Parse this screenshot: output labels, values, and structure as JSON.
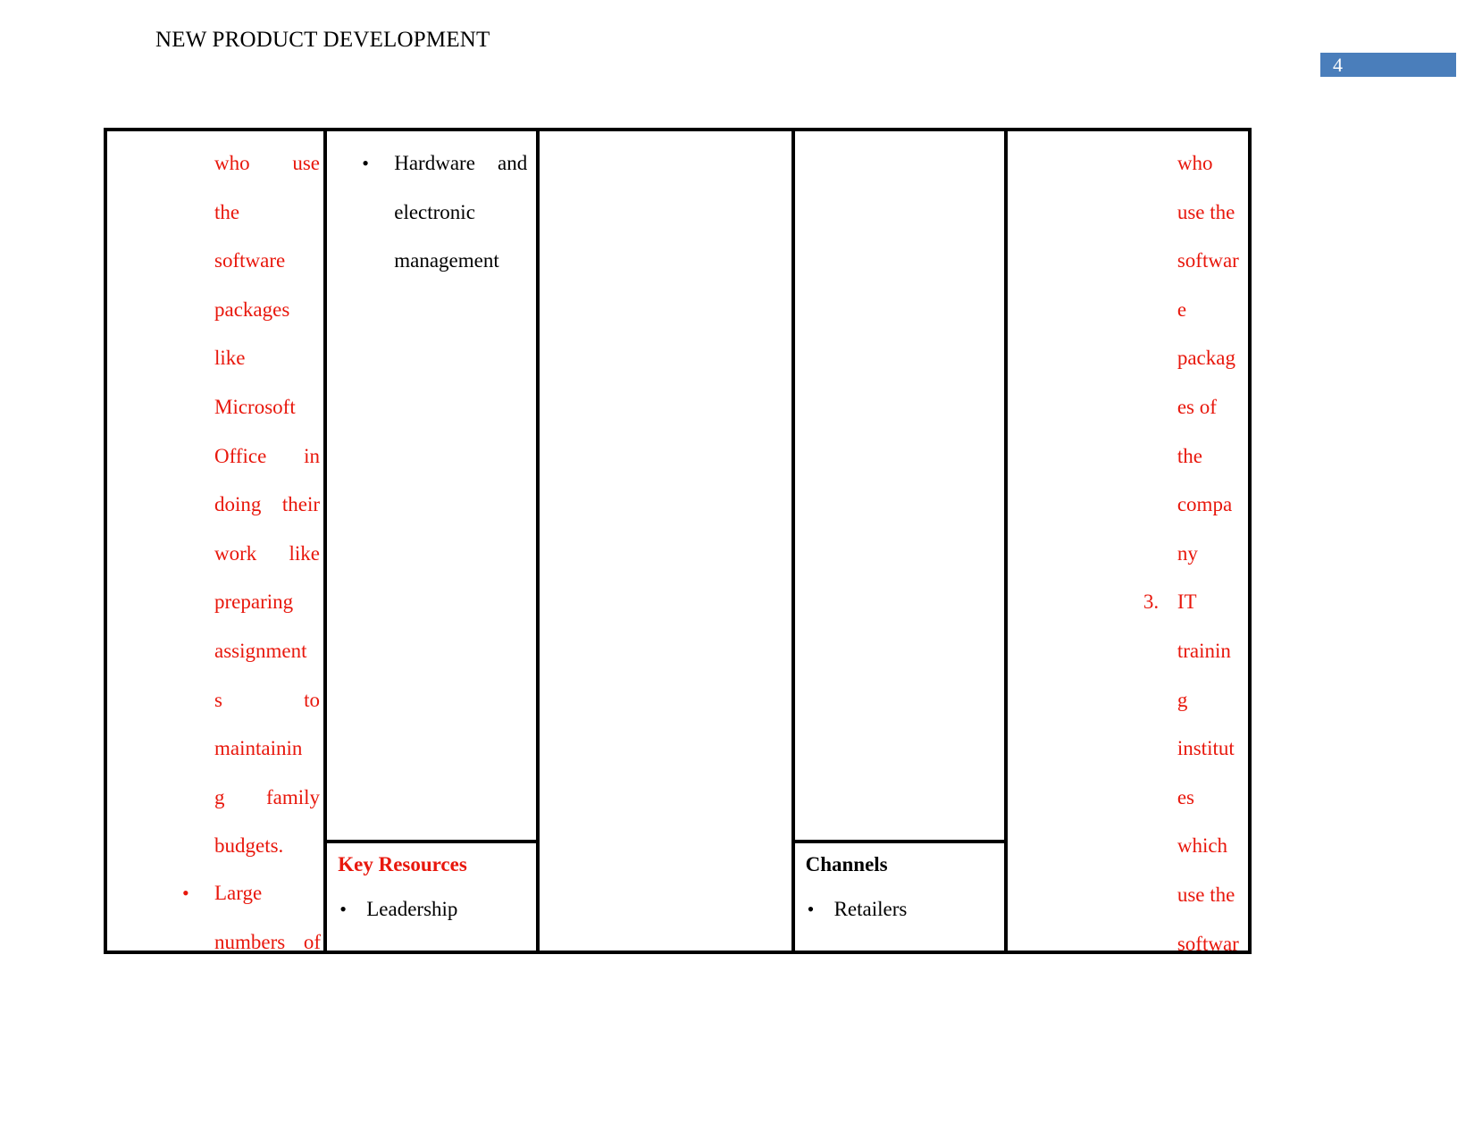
{
  "header": {
    "title": "NEW PRODUCT DEVELOPMENT",
    "page_number": "4",
    "page_bar_color": "#4a7ebb"
  },
  "colors": {
    "red_text": "#e8170c",
    "black_text": "#000000",
    "border": "#000000"
  },
  "table": {
    "columns": [
      {
        "id": "key-partners",
        "top_cell": {
          "paragraph_lines": [
            "who          use",
            "the",
            "software",
            "packages",
            "like",
            "Microsoft",
            "Office       in",
            "doing   their",
            "work     like",
            "preparing",
            "assignment",
            "s            to",
            "maintainin",
            "g     family",
            "budgets."
          ],
          "paragraph_text": "who use the software packages like Microsoft Office in doing their work like preparing assignments to maintaining family budgets.",
          "bullet": {
            "marker": "•",
            "lines": [
              "Large",
              "numbers  of"
            ],
            "text": "Large numbers of"
          }
        },
        "bottom_cell": null
      },
      {
        "id": "key-activities",
        "top_cell": {
          "bullet": {
            "marker": "•",
            "lines": [
              "Hardware  and",
              "electronic",
              "management"
            ],
            "text": "Hardware and electronic management"
          }
        },
        "bottom_cell": {
          "heading": "Key Resources",
          "heading_color": "#e8170c",
          "items": [
            {
              "marker": "•",
              "label": "Leadership"
            }
          ]
        }
      },
      {
        "id": "value-propositions",
        "top_cell": {
          "empty": true
        },
        "bottom_cell": null
      },
      {
        "id": "customer-relationships",
        "top_cell": {
          "empty": true
        },
        "bottom_cell": {
          "heading": "Channels",
          "heading_color": "#000000",
          "items": [
            {
              "marker": "•",
              "label": "Retailers"
            }
          ]
        }
      },
      {
        "id": "customer-segments",
        "top_cell": {
          "paragraph_lines": [
            "who",
            "use the",
            "softwar",
            "e",
            "packag",
            "es of",
            "the",
            "compa",
            "ny"
          ],
          "paragraph_text": "who use the software packages of the company",
          "numbered_item": {
            "number": "3.",
            "lines": [
              "IT",
              "trainin",
              "g",
              "institut",
              "es",
              "which",
              "use the",
              "softwar"
            ],
            "text": "IT training institutes which use the softwar"
          }
        },
        "bottom_cell": null
      }
    ]
  }
}
